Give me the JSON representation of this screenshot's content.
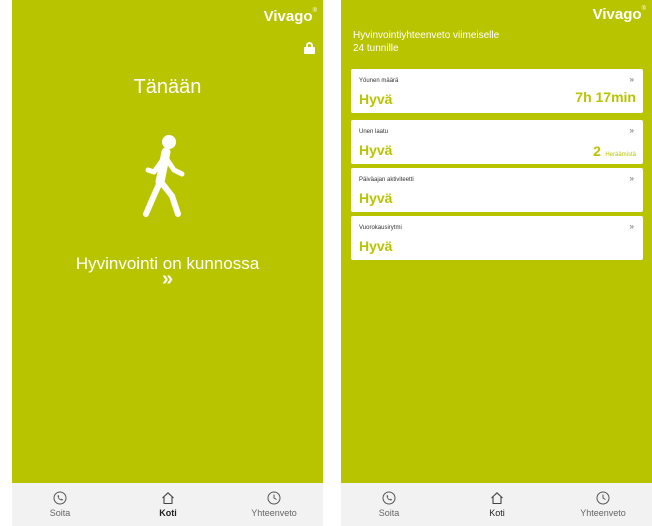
{
  "left_screen": {
    "brand": "Vivago",
    "brand_mark": "®",
    "icons": [
      "lock-icon",
      "walking-person-icon"
    ],
    "title": "Tänään",
    "status": "Hyvinvointi on kunnossa",
    "status_arrow": "»"
  },
  "right_screen": {
    "brand": "Vivago",
    "brand_mark": "®",
    "summary_title_line1": "Hyvinvointiyhteenveto viimeiselle",
    "summary_title_line2": "24 tunnille",
    "cards": [
      {
        "label": "Yöunen määrä",
        "quality": "Hyvä",
        "value": "7h 17min",
        "chevron": "»"
      },
      {
        "label": "Unen laatu",
        "quality": "Hyvä",
        "value_number": "2",
        "value_unit": "Heräämistä",
        "chevron": "»"
      },
      {
        "label": "Päiväajan aktiviteetti",
        "quality": "Hyvä",
        "chevron": "»"
      },
      {
        "label": "Vuorokausirytmi",
        "quality": "Hyvä",
        "chevron": "»"
      }
    ]
  },
  "tabbar": {
    "tabs": [
      {
        "label": "Soita",
        "icon": "phone-icon"
      },
      {
        "label": "Koti",
        "icon": "home-icon"
      },
      {
        "label": "Yhteenveto",
        "icon": "clock-icon"
      }
    ],
    "active": "Koti"
  },
  "colors": {
    "accent": "#b9c400",
    "tabbar_bg": "#f2f2f2",
    "card_bg": "#ffffff"
  }
}
